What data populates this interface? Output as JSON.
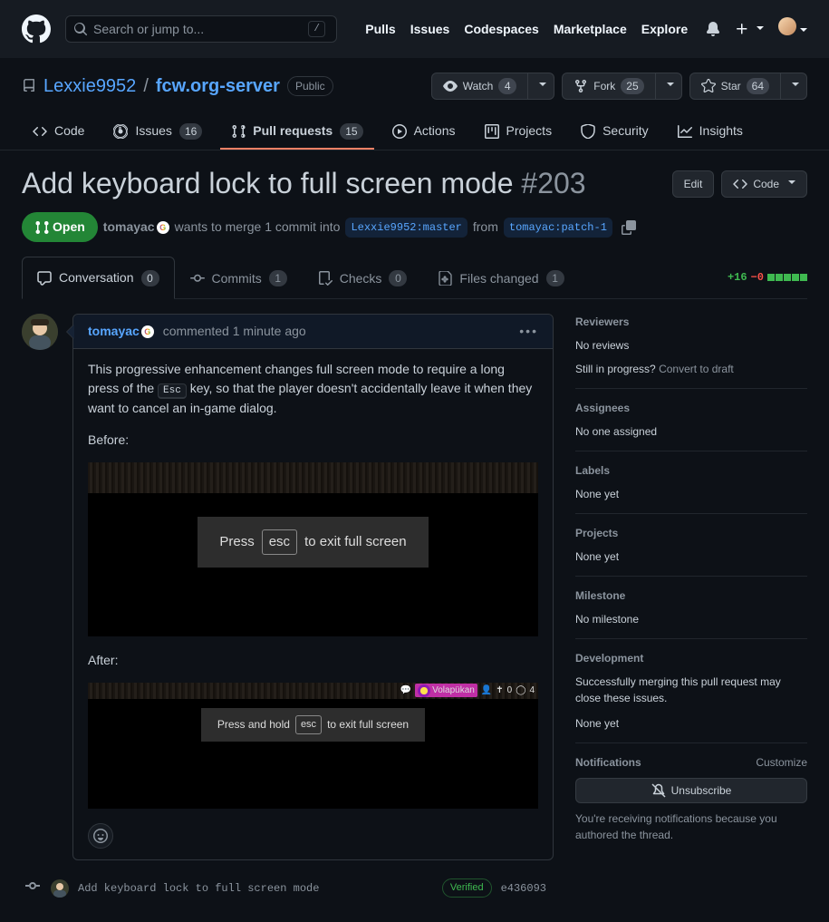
{
  "search_placeholder": "Search or jump to...",
  "search_key": "/",
  "global_nav": {
    "pulls": "Pulls",
    "issues": "Issues",
    "codespaces": "Codespaces",
    "marketplace": "Marketplace",
    "explore": "Explore"
  },
  "repo": {
    "owner": "Lexxie9952",
    "name": "fcw.org-server",
    "visibility": "Public",
    "watch_label": "Watch",
    "watch_count": "4",
    "fork_label": "Fork",
    "fork_count": "25",
    "star_label": "Star",
    "star_count": "64"
  },
  "repo_tabs": {
    "code": "Code",
    "issues": "Issues",
    "issues_count": "16",
    "pulls": "Pull requests",
    "pulls_count": "15",
    "actions": "Actions",
    "projects": "Projects",
    "security": "Security",
    "insights": "Insights"
  },
  "pr": {
    "title": "Add keyboard lock to full screen mode",
    "number": "#203",
    "edit_label": "Edit",
    "code_btn_label": "Code",
    "state": "Open",
    "author": "tomayac",
    "merge_text_1": "wants to merge 1 commit into",
    "base_branch": "Lexxie9952:master",
    "merge_text_2": "from",
    "head_branch": "tomayac:patch-1"
  },
  "pr_tabs": {
    "conversation": "Conversation",
    "conversation_count": "0",
    "commits": "Commits",
    "commits_count": "1",
    "checks": "Checks",
    "checks_count": "0",
    "files": "Files changed",
    "files_count": "1"
  },
  "diff": {
    "add": "+16",
    "del": "−0"
  },
  "comment": {
    "author": "tomayac",
    "time": "commented 1 minute ago",
    "body_p1a": "This progressive enhancement changes full screen mode to require a long press of the ",
    "esc_key": "Esc",
    "body_p1b": " key, so that the player doesn't accidentally leave it when they want to cancel an in-game dialog.",
    "before_label": "Before:",
    "after_label": "After:",
    "banner1_pre": "Press",
    "banner1_key": "esc",
    "banner1_post": "to exit full screen",
    "banner2_pre": "Press and hold",
    "banner2_key": "esc",
    "banner2_post": "to exit full screen",
    "nation": "Volapükan",
    "stat1": "0",
    "stat2": "4"
  },
  "commit": {
    "message": "Add keyboard lock to full screen mode",
    "verified": "Verified",
    "sha": "e436093"
  },
  "sidebar": {
    "reviewers_h": "Reviewers",
    "reviewers_v": "No reviews",
    "draft_q": "Still in progress?",
    "draft_link": "Convert to draft",
    "assignees_h": "Assignees",
    "assignees_v": "No one assigned",
    "labels_h": "Labels",
    "labels_v": "None yet",
    "projects_h": "Projects",
    "projects_v": "None yet",
    "milestone_h": "Milestone",
    "milestone_v": "No milestone",
    "development_h": "Development",
    "development_v": "Successfully merging this pull request may close these issues.",
    "development_v2": "None yet",
    "notifications_h": "Notifications",
    "customize": "Customize",
    "unsubscribe": "Unsubscribe",
    "notif_note": "You're receiving notifications because you authored the thread."
  }
}
